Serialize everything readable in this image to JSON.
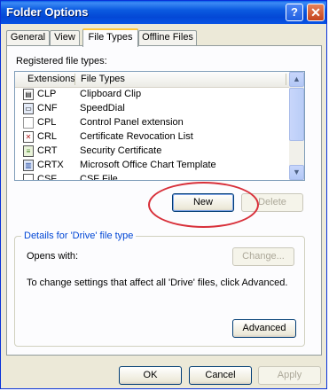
{
  "window": {
    "title": "Folder Options"
  },
  "titlebar": {
    "help_label": "?",
    "close_label": "✕"
  },
  "tabs": [
    {
      "label": "General"
    },
    {
      "label": "View"
    },
    {
      "label": "File Types"
    },
    {
      "label": "Offline Files"
    }
  ],
  "registered_label": "Registered file types:",
  "list": {
    "columns": [
      "Extensions",
      "File Types"
    ],
    "rows": [
      {
        "ext": "CLP",
        "type": "Clipboard Clip",
        "icon": "clipboard-file-icon"
      },
      {
        "ext": "CNF",
        "type": "SpeedDial",
        "icon": "speeddial-file-icon"
      },
      {
        "ext": "CPL",
        "type": "Control Panel extension",
        "icon": "control-panel-file-icon"
      },
      {
        "ext": "CRL",
        "type": "Certificate Revocation List",
        "icon": "certificate-revocation-file-icon"
      },
      {
        "ext": "CRT",
        "type": "Security Certificate",
        "icon": "certificate-file-icon"
      },
      {
        "ext": "CRTX",
        "type": "Microsoft Office Chart Template",
        "icon": "chart-template-file-icon"
      },
      {
        "ext": "CSF",
        "type": "CSF File",
        "icon": "generic-file-icon"
      }
    ]
  },
  "buttons": {
    "new": "New",
    "delete": "Delete",
    "change": "Change...",
    "advanced": "Advanced",
    "ok": "OK",
    "cancel": "Cancel",
    "apply": "Apply"
  },
  "details": {
    "title": "Details for 'Drive' file type",
    "opens_with": "Opens with:",
    "info": "To change settings that affect all 'Drive' files, click Advanced."
  },
  "colors": {
    "highlight_circle": "#d8303a",
    "titlebar": "#0b5ae0"
  }
}
